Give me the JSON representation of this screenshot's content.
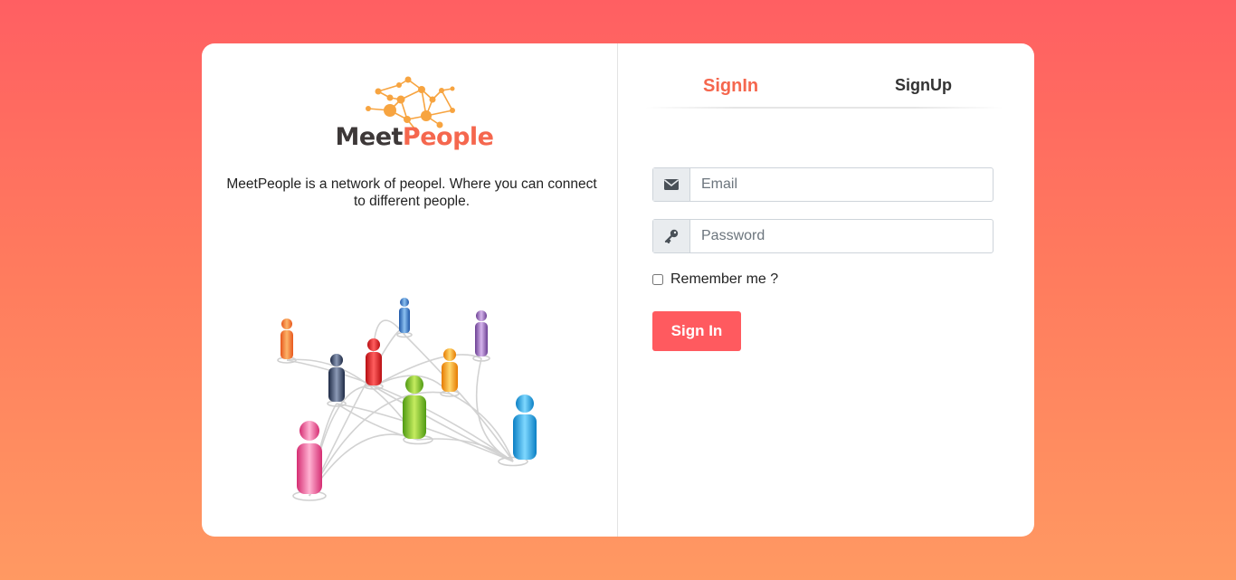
{
  "brand": {
    "name_part1": "Meet",
    "name_part2": "People",
    "tagline": "MeetPeople is a network of peopel. Where you can connect to different people.",
    "colors": {
      "accent": "#f5674e",
      "dark": "#3d3838"
    }
  },
  "tabs": [
    {
      "label": "SignIn",
      "active": true
    },
    {
      "label": "SignUp",
      "active": false
    }
  ],
  "form": {
    "email": {
      "icon": "envelope-icon",
      "placeholder": "Email",
      "value": ""
    },
    "password": {
      "icon": "key-icon",
      "placeholder": "Password",
      "value": ""
    },
    "remember_label": "Remember me ?",
    "remember_checked": false,
    "submit_label": "Sign In",
    "submit_color": "#ff5a5f"
  },
  "background": {
    "gradient_top": "#ff5f62",
    "gradient_bottom": "#ff9962"
  }
}
